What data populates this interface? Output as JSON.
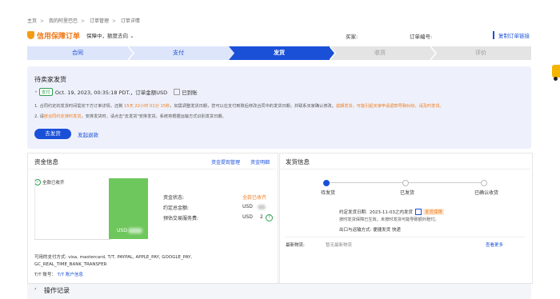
{
  "breadcrumb": [
    "主页",
    "我的阿里巴巴",
    "订单管理",
    "订单详情"
  ],
  "header": {
    "title": "信用保障订单",
    "subtitle": "保障中，额度去向",
    "buyer_label": "买家:",
    "order_no_label": "订单编号:",
    "copy_link": "复制订单链接"
  },
  "steps": [
    "合同",
    "支付",
    "发货",
    "收货",
    "评价"
  ],
  "active_step": "发货",
  "status_panel": {
    "title": "待卖家发货",
    "paid_badge": "支付",
    "paid_text": "Oct. 19, 2023, 00:35:18 PDT.，订单金额USD",
    "received_text": "已到账",
    "note1_a": "1. 合同约定的发货时间需完下方订单详情，还剩 ",
    "note1_time": "15天 22小时 01分 15秒",
    "note1_b": "，如需调整发货日期，您可以在支付到账后修改合同中的发货日期，并联系买家确认修改。",
    "note1_orange": "逾期发货，可能引起买家申请退款导致纠纷，请及时发货。",
    "note2_a": "2. 请",
    "note2_orange": "按合同约定准时发货",
    "note2_b": "，安排发货时，请点击\"去发货\"安排发货。系统将根据运输方式识别发货日期。",
    "ship_button": "去发货",
    "refund_link": "发起退款"
  },
  "fund_card": {
    "title": "资金信息",
    "link1": "资金提现管理",
    "link2": "资金明细",
    "fully_received": "全款已收齐",
    "bar_currency": "USD",
    "rows": [
      {
        "label": "资金状态:",
        "value": "全款已收齐"
      },
      {
        "label": "约定总金额:",
        "value": "USD"
      },
      {
        "label": "预估交易服务费:",
        "value": "USD"
      }
    ],
    "fee_suffix": "2",
    "pay_methods": "可用的支付方式: visa, mastercard, T/T, PAYPAL, APPLE_PAY, GOOGLE_PAY, GC_REAL_TIME_BANK_TRANSFER",
    "tt_label": "T/T 账号：",
    "tt_link": "T/T 账户信息"
  },
  "ship_card": {
    "title": "发货信息",
    "timeline": [
      "待发货",
      "已发货",
      "已确认收货"
    ],
    "agreed_date_label": "约定发货日期:",
    "agreed_date": "2023-11-03之内发货",
    "guarantee_badge": "发货保障",
    "guarantee_note": "按时发货保障已生效，未按时发货可能导致额外赔付。",
    "port_label": "出口与运输方式:",
    "port_value": "便捷发货 快递",
    "latest_label": "最新物流:",
    "latest_value": "暂无最新物流",
    "more_link": "查看更多"
  },
  "operations": {
    "title": "操作记录"
  },
  "colors": {
    "accent": "#1a50d8",
    "orange": "#f07b1d",
    "green": "#6ec75c",
    "panel": "#eef1fb"
  }
}
